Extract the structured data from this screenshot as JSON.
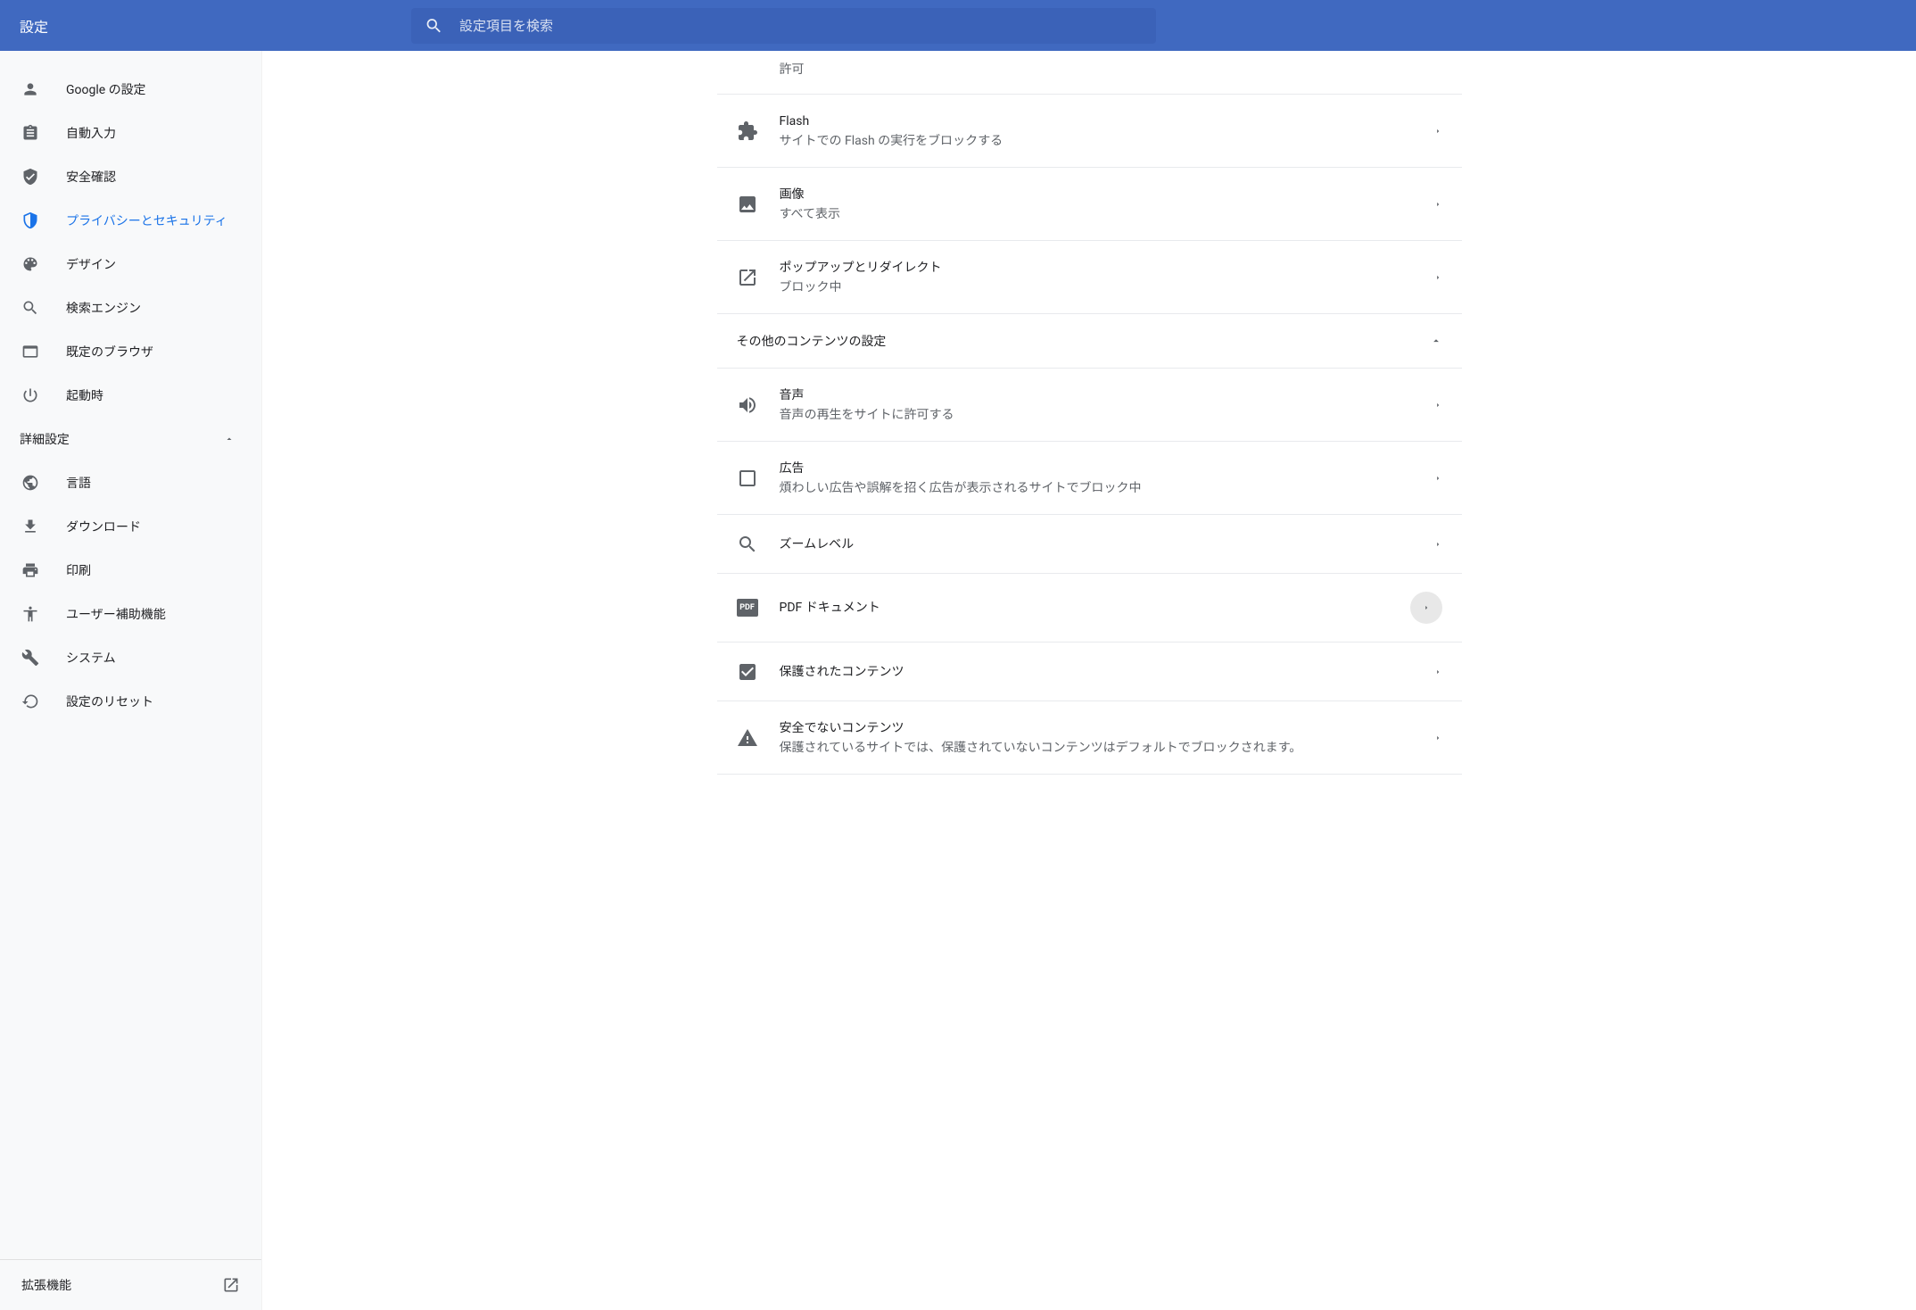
{
  "header": {
    "title": "設定",
    "search_placeholder": "設定項目を検索"
  },
  "sidebar": {
    "items": [
      {
        "icon": "person",
        "label": "Google の設定"
      },
      {
        "icon": "clipboard",
        "label": "自動入力"
      },
      {
        "icon": "shield-check",
        "label": "安全確認"
      },
      {
        "icon": "shield",
        "label": "プライバシーとセキュリティ",
        "active": true
      },
      {
        "icon": "palette",
        "label": "デザイン"
      },
      {
        "icon": "search",
        "label": "検索エンジン"
      },
      {
        "icon": "browser",
        "label": "既定のブラウザ"
      },
      {
        "icon": "power",
        "label": "起動時"
      }
    ],
    "advanced_label": "詳細設定",
    "advanced_items": [
      {
        "icon": "globe",
        "label": "言語"
      },
      {
        "icon": "download",
        "label": "ダウンロード"
      },
      {
        "icon": "print",
        "label": "印刷"
      },
      {
        "icon": "accessibility",
        "label": "ユーザー補助機能"
      },
      {
        "icon": "wrench",
        "label": "システム"
      },
      {
        "icon": "restore",
        "label": "設定のリセット"
      }
    ],
    "extensions_label": "拡張機能"
  },
  "main": {
    "partial_row_sub": "許可",
    "rows_top": [
      {
        "icon": "puzzle",
        "title": "Flash",
        "sub": "サイトでの Flash の実行をブロックする"
      },
      {
        "icon": "image",
        "title": "画像",
        "sub": "すべて表示"
      },
      {
        "icon": "popup",
        "title": "ポップアップとリダイレクト",
        "sub": "ブロック中"
      }
    ],
    "section_header": "その他のコンテンツの設定",
    "rows_bottom": [
      {
        "icon": "sound",
        "title": "音声",
        "sub": "音声の再生をサイトに許可する"
      },
      {
        "icon": "ad",
        "title": "広告",
        "sub": "煩わしい広告や誤解を招く広告が表示されるサイトでブロック中"
      },
      {
        "icon": "zoom",
        "title": "ズームレベル",
        "sub": ""
      },
      {
        "icon": "pdf",
        "title": "PDF ドキュメント",
        "sub": "",
        "circled": true
      },
      {
        "icon": "protected",
        "title": "保護されたコンテンツ",
        "sub": ""
      },
      {
        "icon": "warning",
        "title": "安全でないコンテンツ",
        "sub": "保護されているサイトでは、保護されていないコンテンツはデフォルトでブロックされます。"
      }
    ]
  }
}
